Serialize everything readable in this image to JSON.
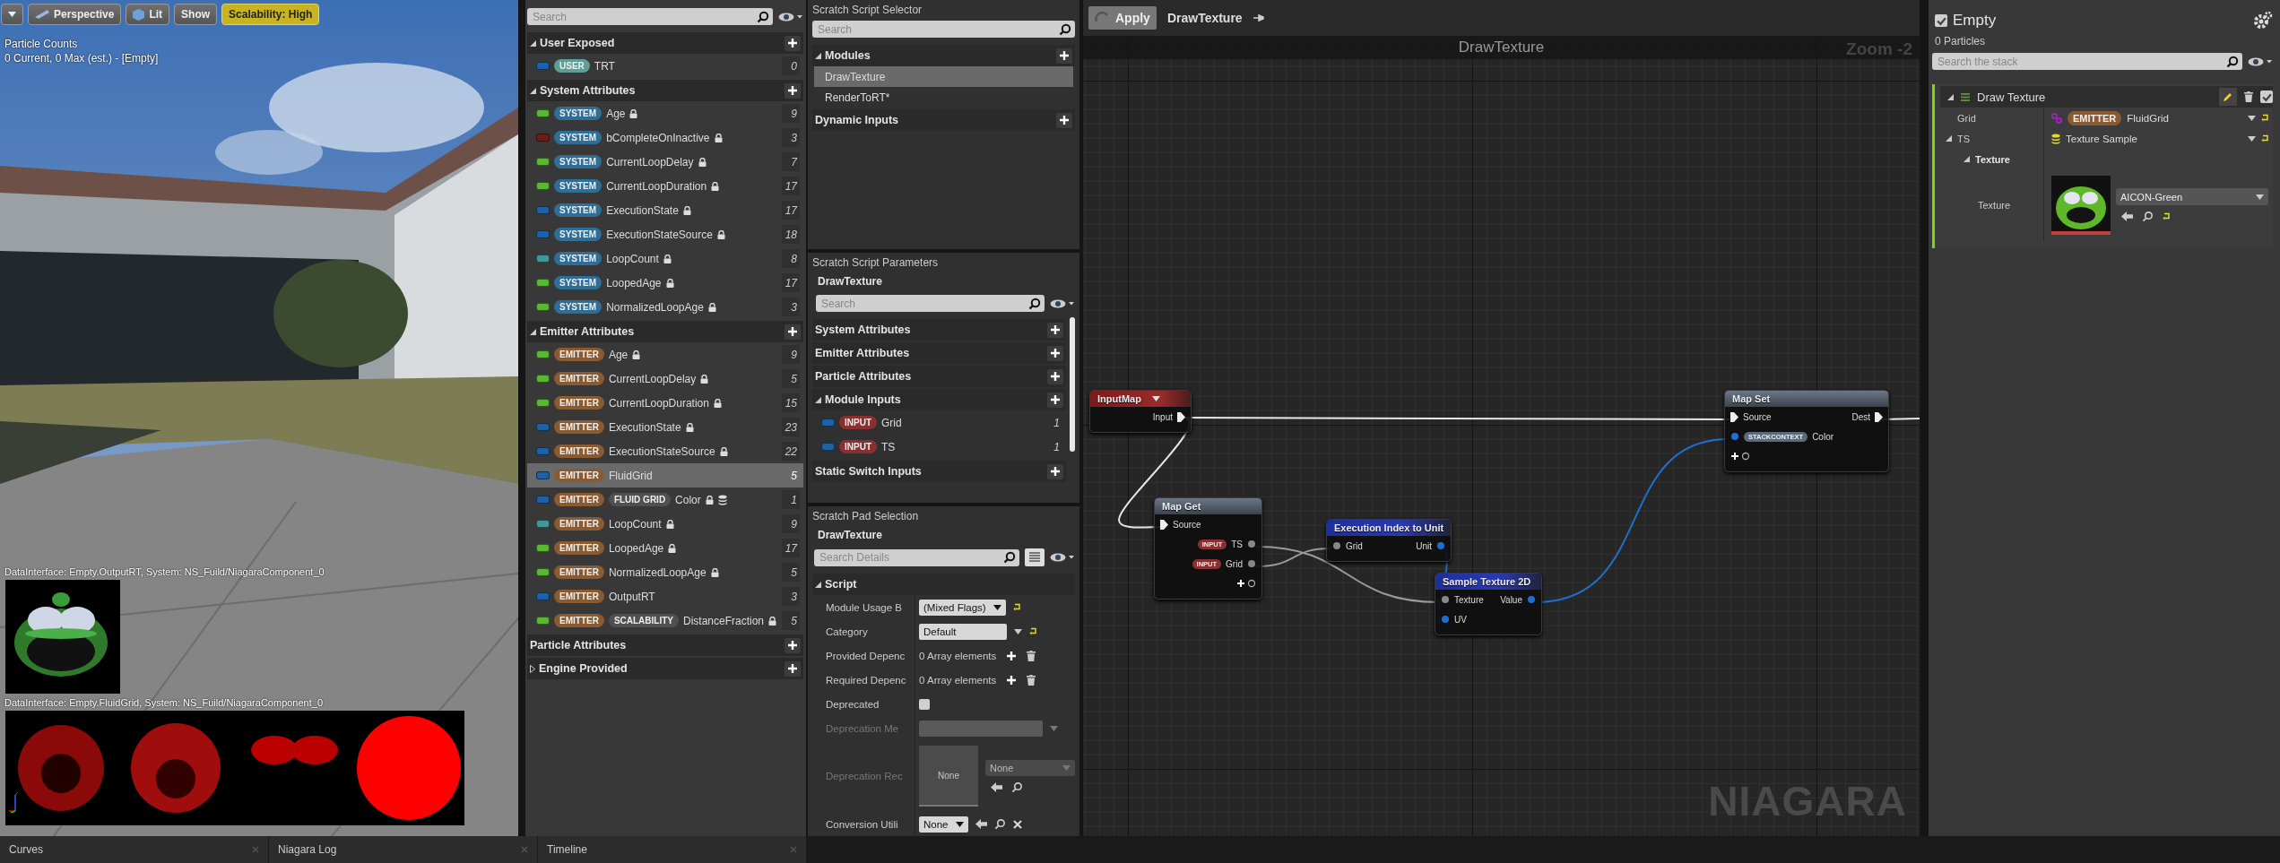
{
  "viewport": {
    "toolbar": [
      {
        "kind": "menu"
      },
      {
        "kind": "perspective",
        "label": "Perspective"
      },
      {
        "kind": "lit",
        "label": "Lit"
      },
      {
        "kind": "plain",
        "label": "Show"
      },
      {
        "kind": "warning",
        "label": "Scalability: High"
      }
    ],
    "stats_title": "Particle Counts",
    "stats": "0 Current, 0 Max (est.) - [Empty]",
    "debug_textures": [
      {
        "caption": "DataInterface: Empty.OutputRT, System: NS_Fuild/NiagaraComponent_0",
        "kind": "picture"
      },
      {
        "caption": "DataInterface: Empty.FluidGrid, System: NS_Fuild/NiagaraComponent_0",
        "kind": "picture"
      }
    ]
  },
  "parameters": {
    "search": {
      "placeholder": "Search"
    },
    "sections": [
      {
        "title": "User Exposed",
        "kind": "expanded",
        "items": [
          {
            "color": "#1d62a8",
            "tags": [
              {
                "label": "USER",
                "kind": "user"
              }
            ],
            "name": "TRT",
            "locked": false,
            "data_icon": false,
            "count": "0",
            "selected": false
          }
        ]
      },
      {
        "title": "System Attributes",
        "kind": "expanded",
        "items": [
          {
            "color": "#58b832",
            "tags": [
              {
                "label": "SYSTEM",
                "kind": "system"
              }
            ],
            "name": "Age",
            "locked": true,
            "data_icon": false,
            "count": "9",
            "selected": false
          },
          {
            "color": "#6e1d12",
            "tags": [
              {
                "label": "SYSTEM",
                "kind": "system"
              }
            ],
            "name": "bCompleteOnInactive",
            "locked": true,
            "data_icon": false,
            "count": "3",
            "selected": false
          },
          {
            "color": "#58b832",
            "tags": [
              {
                "label": "SYSTEM",
                "kind": "system"
              }
            ],
            "name": "CurrentLoopDelay",
            "locked": true,
            "data_icon": false,
            "count": "7",
            "selected": false
          },
          {
            "color": "#58b832",
            "tags": [
              {
                "label": "SYSTEM",
                "kind": "system"
              }
            ],
            "name": "CurrentLoopDuration",
            "locked": true,
            "data_icon": false,
            "count": "17",
            "selected": false
          },
          {
            "color": "#1d62a8",
            "tags": [
              {
                "label": "SYSTEM",
                "kind": "system"
              }
            ],
            "name": "ExecutionState",
            "locked": true,
            "data_icon": false,
            "count": "17",
            "selected": false
          },
          {
            "color": "#1d62a8",
            "tags": [
              {
                "label": "SYSTEM",
                "kind": "system"
              }
            ],
            "name": "ExecutionStateSource",
            "locked": true,
            "data_icon": false,
            "count": "18",
            "selected": false
          },
          {
            "color": "#3e9a96",
            "tags": [
              {
                "label": "SYSTEM",
                "kind": "system"
              }
            ],
            "name": "LoopCount",
            "locked": true,
            "data_icon": false,
            "count": "8",
            "selected": false
          },
          {
            "color": "#58b832",
            "tags": [
              {
                "label": "SYSTEM",
                "kind": "system"
              }
            ],
            "name": "LoopedAge",
            "locked": true,
            "data_icon": false,
            "count": "17",
            "selected": false
          },
          {
            "color": "#58b832",
            "tags": [
              {
                "label": "SYSTEM",
                "kind": "system"
              }
            ],
            "name": "NormalizedLoopAge",
            "locked": true,
            "data_icon": false,
            "count": "3",
            "selected": false
          }
        ]
      },
      {
        "title": "Emitter Attributes",
        "kind": "expanded",
        "items": [
          {
            "color": "#58b832",
            "tags": [
              {
                "label": "EMITTER",
                "kind": "emitter"
              }
            ],
            "name": "Age",
            "locked": true,
            "data_icon": false,
            "count": "9",
            "selected": false
          },
          {
            "color": "#58b832",
            "tags": [
              {
                "label": "EMITTER",
                "kind": "emitter"
              }
            ],
            "name": "CurrentLoopDelay",
            "locked": true,
            "data_icon": false,
            "count": "5",
            "selected": false
          },
          {
            "color": "#58b832",
            "tags": [
              {
                "label": "EMITTER",
                "kind": "emitter"
              }
            ],
            "name": "CurrentLoopDuration",
            "locked": true,
            "data_icon": false,
            "count": "15",
            "selected": false
          },
          {
            "color": "#1d62a8",
            "tags": [
              {
                "label": "EMITTER",
                "kind": "emitter"
              }
            ],
            "name": "ExecutionState",
            "locked": true,
            "data_icon": false,
            "count": "23",
            "selected": false
          },
          {
            "color": "#1d62a8",
            "tags": [
              {
                "label": "EMITTER",
                "kind": "emitter"
              }
            ],
            "name": "ExecutionStateSource",
            "locked": true,
            "data_icon": false,
            "count": "22",
            "selected": false
          },
          {
            "color": "#1d62a8",
            "tags": [
              {
                "label": "EMITTER",
                "kind": "emitter"
              }
            ],
            "name": "FluidGrid",
            "locked": false,
            "data_icon": false,
            "count": "5",
            "selected": true
          },
          {
            "color": "#1d62a8",
            "tags": [
              {
                "label": "EMITTER",
                "kind": "emitter"
              },
              {
                "label": "FLUID GRID",
                "kind": "sub"
              }
            ],
            "name": "Color",
            "locked": true,
            "data_icon": true,
            "count": "1",
            "selected": false
          },
          {
            "color": "#3e9a96",
            "tags": [
              {
                "label": "EMITTER",
                "kind": "emitter"
              }
            ],
            "name": "LoopCount",
            "locked": true,
            "data_icon": false,
            "count": "9",
            "selected": false
          },
          {
            "color": "#58b832",
            "tags": [
              {
                "label": "EMITTER",
                "kind": "emitter"
              }
            ],
            "name": "LoopedAge",
            "locked": true,
            "data_icon": false,
            "count": "17",
            "selected": false
          },
          {
            "color": "#58b832",
            "tags": [
              {
                "label": "EMITTER",
                "kind": "emitter"
              }
            ],
            "name": "NormalizedLoopAge",
            "locked": true,
            "data_icon": false,
            "count": "5",
            "selected": false
          },
          {
            "color": "#1d62a8",
            "tags": [
              {
                "label": "EMITTER",
                "kind": "emitter"
              }
            ],
            "name": "OutputRT",
            "locked": false,
            "data_icon": false,
            "count": "3",
            "selected": false
          },
          {
            "color": "#58b832",
            "tags": [
              {
                "label": "EMITTER",
                "kind": "emitter"
              },
              {
                "label": "SCALABILITY",
                "kind": "sub"
              }
            ],
            "name": "DistanceFraction",
            "locked": true,
            "data_icon": false,
            "count": "5",
            "selected": false
          }
        ]
      },
      {
        "title": "Particle Attributes",
        "kind": "leaf"
      },
      {
        "title": "Engine Provided",
        "kind": "collapsed"
      }
    ]
  },
  "script_selector": {
    "title": "Scratch Script Selector",
    "search": {
      "placeholder": "Search"
    },
    "sections": [
      {
        "title": "Modules",
        "kind": "expanded",
        "entries": [
          {
            "label": "DrawTexture",
            "selected": true
          },
          {
            "label": "RenderToRT*",
            "selected": false
          }
        ]
      },
      {
        "title": "Dynamic Inputs",
        "kind": "leaf"
      }
    ]
  },
  "script_parameters": {
    "title": "Scratch Script Parameters",
    "subtitle": "DrawTexture",
    "search": {
      "placeholder": "Search"
    },
    "sections": [
      {
        "title": "System Attributes",
        "kind": "leaf"
      },
      {
        "title": "Emitter Attributes",
        "kind": "leaf"
      },
      {
        "title": "Particle Attributes",
        "kind": "leaf"
      },
      {
        "title": "Module Inputs",
        "kind": "expanded",
        "items": [
          {
            "color": "#1d62a8",
            "tags": [
              {
                "label": "INPUT",
                "kind": "input"
              }
            ],
            "name": "Grid",
            "locked": false,
            "data_icon": false,
            "count": "1",
            "selected": false
          },
          {
            "color": "#1d62a8",
            "tags": [
              {
                "label": "INPUT",
                "kind": "input"
              }
            ],
            "name": "TS",
            "locked": false,
            "data_icon": false,
            "count": "1",
            "selected": false
          }
        ]
      },
      {
        "title": "Static Switch Inputs",
        "kind": "leaf"
      }
    ]
  },
  "pad_selection": {
    "title": "Scratch Pad Selection",
    "subtitle": "DrawTexture",
    "search": {
      "placeholder": "Search Details"
    },
    "category": "Script",
    "rows": [
      {
        "label": "Module Usage B",
        "kind": "dropdown",
        "value": "(Mixed Flags)",
        "reset": true,
        "disabled": false
      },
      {
        "label": "Category",
        "kind": "combo",
        "value": "Default",
        "reset": true,
        "disabled": false
      },
      {
        "label": "Provided Depenc",
        "kind": "array",
        "value": "0 Array elements",
        "reset": false,
        "disabled": false
      },
      {
        "label": "Required Depenc",
        "kind": "array",
        "value": "0 Array elements",
        "reset": false,
        "disabled": false
      },
      {
        "label": "Deprecated",
        "kind": "checkbox",
        "checked": false,
        "reset": false,
        "disabled": false
      },
      {
        "label": "Deprecation Me",
        "kind": "field",
        "reset": false,
        "disabled": true
      },
      {
        "label": "Deprecation Rec",
        "kind": "asset",
        "thumb": "None",
        "value": "None",
        "reset": false,
        "disabled": true
      },
      {
        "label": "Conversion Utili",
        "kind": "small_dropdown",
        "value": "None",
        "reset": false,
        "disabled": false
      }
    ]
  },
  "graph": {
    "apply": "Apply",
    "tab_title": "DrawTexture",
    "title": "DrawTexture",
    "zoom": "Zoom -2",
    "corner_label": "NIAGARA",
    "nodes": [
      {
        "kind": "input_map",
        "title": "InputMap",
        "rows": [
          {
            "out": {
              "label": "Input",
              "kind": "exec"
            }
          }
        ]
      },
      {
        "kind": "map",
        "title": "Map Get",
        "rows": [
          {
            "in": {
              "label": "Source",
              "kind": "exec"
            }
          },
          {
            "out": {
              "tag": "INPUT",
              "label": "TS",
              "kind": "object"
            }
          },
          {
            "out": {
              "tag": "INPUT",
              "label": "Grid",
              "kind": "object"
            }
          },
          {
            "out": {
              "kind": "add"
            }
          }
        ]
      },
      {
        "kind": "call",
        "title": "Execution Index to Unit",
        "rows": [
          {
            "in": {
              "label": "Grid",
              "kind": "object"
            },
            "out": {
              "label": "Unit",
              "kind": "vector"
            }
          }
        ]
      },
      {
        "kind": "call",
        "title": "Sample Texture 2D",
        "rows": [
          {
            "in": {
              "label": "Texture",
              "kind": "object"
            },
            "out": {
              "label": "Value",
              "kind": "vector"
            }
          },
          {
            "in": {
              "label": "UV",
              "kind": "vector"
            }
          }
        ]
      },
      {
        "kind": "map",
        "title": "Map Set",
        "rows": [
          {
            "in": {
              "label": "Source",
              "kind": "exec"
            },
            "out": {
              "label": "Dest",
              "kind": "exec"
            }
          },
          {
            "in": {
              "tag": "STACKCONTEXT",
              "label": "Color",
              "kind": "vector"
            }
          },
          {
            "in": {
              "kind": "add"
            }
          }
        ]
      }
    ]
  },
  "details": {
    "enabled": true,
    "title": "Empty",
    "particles": "0 Particles",
    "search": {
      "placeholder": "Search the stack"
    },
    "module": {
      "title": "Draw Texture",
      "enabled": true,
      "rows": [
        {
          "label": "Grid",
          "kind": "link",
          "tag": "EMITTER",
          "value": "FluidGrid"
        },
        {
          "label": "TS",
          "kind": "data",
          "value": "Texture Sample",
          "expanded": true
        },
        {
          "label": "Texture",
          "kind": "category",
          "expanded": true
        },
        {
          "label": "Texture",
          "kind": "texture",
          "value": "AICON-Green"
        }
      ]
    }
  },
  "bottom_tabs": [
    {
      "label": "Curves"
    },
    {
      "label": "Niagara Log"
    },
    {
      "label": "Timeline"
    }
  ]
}
